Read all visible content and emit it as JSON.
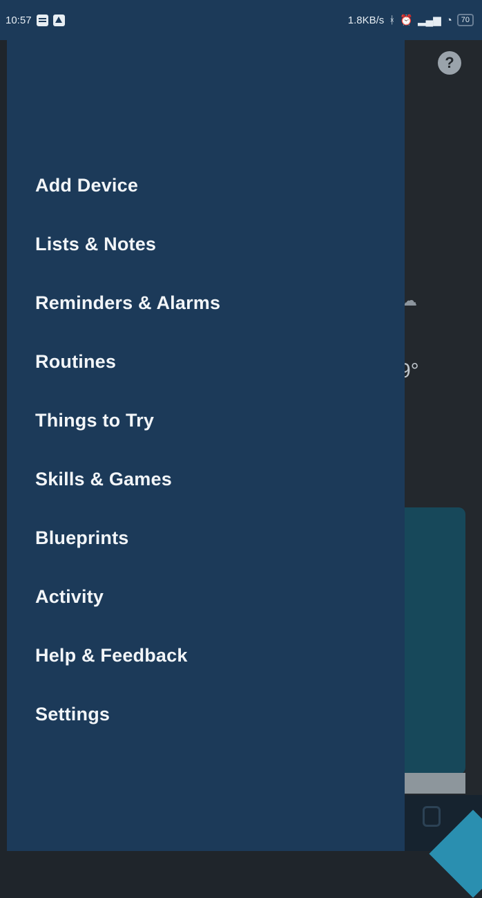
{
  "status_bar": {
    "time": "10:57",
    "left_icons": [
      "message-icon",
      "navigation-icon"
    ],
    "network_speed": "1.8KB/s",
    "right_icons": [
      "bluetooth-icon",
      "alarm-icon",
      "signal-icon",
      "wifi-icon"
    ],
    "battery": "70"
  },
  "drawer": {
    "items": [
      {
        "label": "Add Device"
      },
      {
        "label": "Lists & Notes"
      },
      {
        "label": "Reminders & Alarms"
      },
      {
        "label": "Routines"
      },
      {
        "label": "Things to Try"
      },
      {
        "label": "Skills & Games"
      },
      {
        "label": "Blueprints"
      },
      {
        "label": "Activity"
      },
      {
        "label": "Help & Feedback"
      },
      {
        "label": "Settings"
      }
    ]
  },
  "background": {
    "help_symbol": "?",
    "weather_partial": "9°",
    "colors": {
      "drawer": "#1c3a59",
      "card": "#17485a",
      "accent": "#2a8fb0"
    }
  }
}
